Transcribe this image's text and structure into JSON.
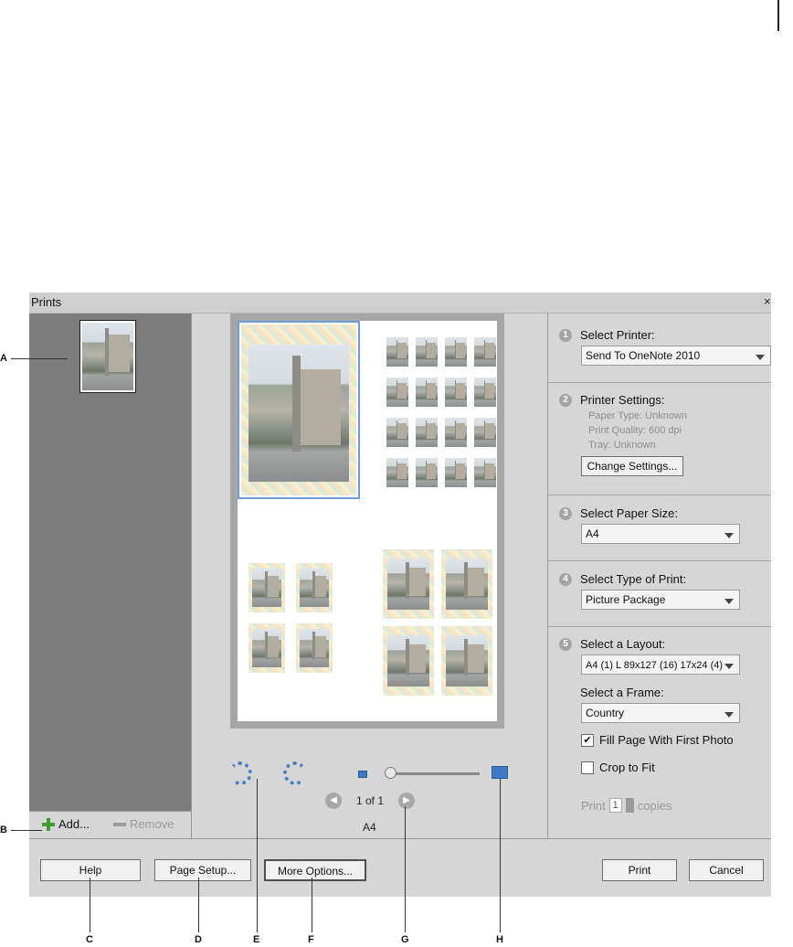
{
  "dialog": {
    "title": "Prints"
  },
  "left": {
    "add_label": "Add...",
    "remove_label": "Remove"
  },
  "preview": {
    "page_counter": "1 of 1",
    "page_size": "A4",
    "zoom_level": 0.05
  },
  "settings": {
    "step1": {
      "num": "1",
      "title": "Select Printer:",
      "value": "Send To OneNote 2010"
    },
    "step2": {
      "num": "2",
      "title": "Printer Settings:",
      "paper_type": "Paper Type: Unknown",
      "print_quality": "Print Quality: 600 dpi",
      "tray": "Tray: Unknown",
      "change_button": "Change Settings..."
    },
    "step3": {
      "num": "3",
      "title": "Select Paper Size:",
      "value": "A4"
    },
    "step4": {
      "num": "4",
      "title": "Select Type of Print:",
      "value": "Picture Package"
    },
    "step5": {
      "num": "5",
      "title": "Select a Layout:",
      "value": "A4 (1) L 89x127 (16) 17x24 (4)",
      "frame_title": "Select a Frame:",
      "frame_value": "Country"
    },
    "fill_page": {
      "label": "Fill Page With First Photo",
      "checked": true,
      "mark": "✔"
    },
    "crop_fit": {
      "label": "Crop to Fit",
      "checked": false
    },
    "copies": {
      "before": "Print",
      "value": "1",
      "after": "copies"
    }
  },
  "bottom": {
    "help": "Help",
    "page_setup": "Page Setup...",
    "more_options": "More Options...",
    "print": "Print",
    "cancel": "Cancel"
  },
  "callouts": {
    "a": "A",
    "b": "B",
    "c": "C",
    "d": "D",
    "e": "E",
    "f": "F",
    "g": "G",
    "h": "H"
  },
  "colors": {
    "accent": "#4a7fc1",
    "selection": "#6f9ed6"
  }
}
